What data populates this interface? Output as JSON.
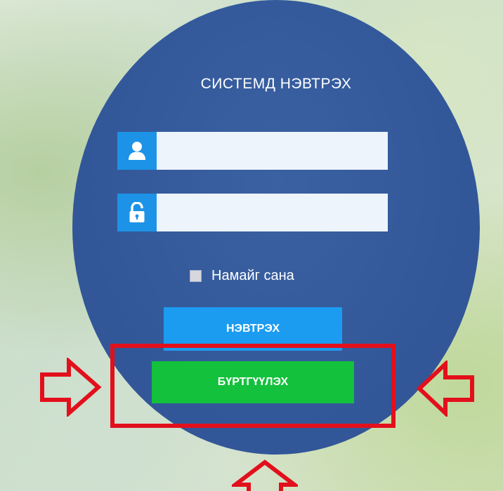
{
  "login": {
    "title": "СИСТЕМД НЭВТРЭХ",
    "username_value": "",
    "password_value": "",
    "remember_label": "Намайг сана",
    "login_button_label": "НЭВТРЭХ",
    "register_button_label": "БҮРТГҮҮЛЭХ"
  },
  "icons": {
    "username": "user-icon",
    "password": "lock-icon"
  },
  "colors": {
    "circle": "#33589a",
    "icon_bg": "#1c93e7",
    "login_button": "#1c9cf0",
    "register_button": "#13c13c",
    "annotation": "#e2101c"
  }
}
